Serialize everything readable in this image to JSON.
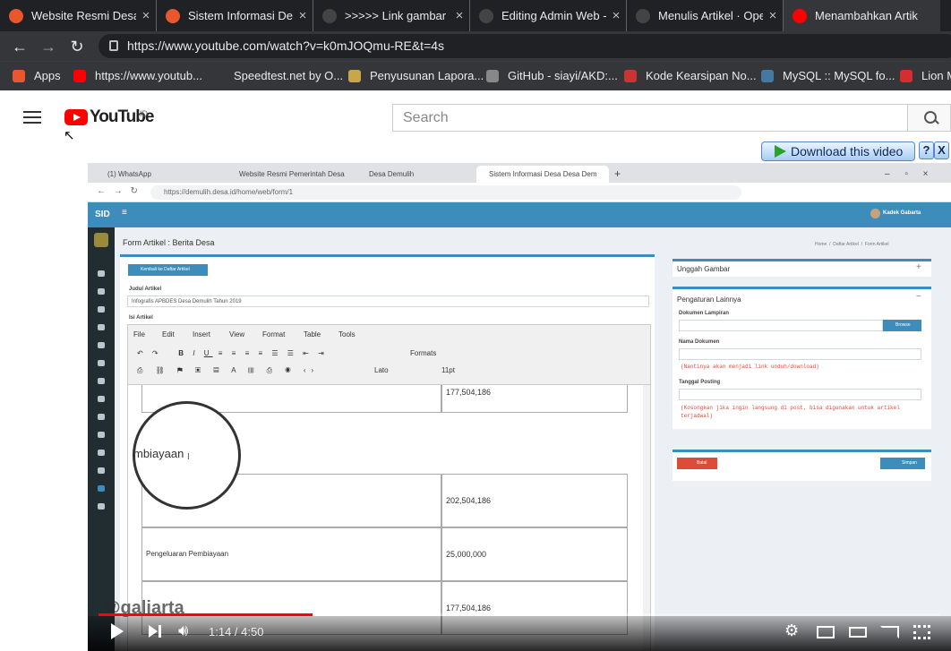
{
  "browser": {
    "tabs": [
      {
        "label": "Website Resmi Desa",
        "fav_color": "#e8572d"
      },
      {
        "label": "Sistem Informasi Des",
        "fav_color": "#e8572d"
      },
      {
        "label": ">>>>> Link gambar",
        "fav_color": "#444444"
      },
      {
        "label": "Editing Admin Web -",
        "fav_color": "#444444"
      },
      {
        "label": "Menulis Artikel · Ope",
        "fav_color": "#444444"
      },
      {
        "label": "Menambahkan Artik",
        "fav_color": "#ff0000"
      }
    ],
    "close_glyph": "×",
    "url": "https://www.youtube.com/watch?v=k0mJOQmu-RE&t=4s",
    "bookmarks": [
      {
        "label": "Apps",
        "color": "#e8572d"
      },
      {
        "label": "https://www.youtub...",
        "color": "#ff0000"
      },
      {
        "label": "Speedtest.net by O...",
        "color": "#35363a"
      },
      {
        "label": "Penyusunan Lapora...",
        "color": "#caa64a"
      },
      {
        "label": "GitHub - siayi/AKD:...",
        "color": "#888888"
      },
      {
        "label": "Kode Kearsipan No...",
        "color": "#cc3333"
      },
      {
        "label": "MySQL :: MySQL fo...",
        "color": "#4479a1"
      },
      {
        "label": "Lion M",
        "color": "#d62e2e"
      }
    ]
  },
  "youtube": {
    "logo_text": "YouTube",
    "region": "ID",
    "search_placeholder": "Search",
    "download_label": "Download this video",
    "help_label": "?",
    "close_label": "X"
  },
  "video": {
    "inner_tabs": [
      "(1) WhatsApp",
      "Website Resmi Pemerintah Desa",
      "Desa Demulih",
      "Sistem Informasi Desa Desa Dem"
    ],
    "inner_url": "https://demulih.desa.id/home/web/form/1",
    "sid_brand": "SID",
    "user_name": "Kadek Gabarta",
    "page_title": "Form Artikel : Berita Desa",
    "breadcrumb": "Home  /  Daftar Artikel  /  Form Artikel",
    "back_button": "Kembali ke Daftar Artikel",
    "judul_label": "Judul Artikel",
    "judul_value": "Infografis APBDES Desa Demulih Tahun 2019",
    "isi_label": "Isi Artikel",
    "editor_menu": [
      "File",
      "Edit",
      "Insert",
      "View",
      "Format",
      "Table",
      "Tools"
    ],
    "editor_formats": "Formats",
    "editor_font": "Lato",
    "editor_size": "11pt",
    "table_rows": [
      {
        "label": "",
        "value": "177,504,186"
      },
      {
        "label": "",
        "value": "202,504,186"
      },
      {
        "label": "Pengeluaran Pembiayaan",
        "value": "25,000,000"
      },
      {
        "label": "",
        "value": "177,504,186"
      }
    ],
    "magnified_text": "mbiayaan",
    "unggah_gambar": "Unggah Gambar",
    "pengaturan": "Pengaturan Lainnya",
    "lampiran_label": "Dokumen Lampiran",
    "browse_button": "Browse",
    "nama_dokumen_label": "Nama Dokumen",
    "nama_dokumen_hint": "(Nantinya akan menjadi link unduh/download)",
    "tanggal_label": "Tanggal Posting",
    "tanggal_hint": "(Kosongkan jika ingin langsung di post, bisa digunakan untuk artikel terjadwal)",
    "batal_button": "Batal",
    "simpan_button": "Simpan",
    "watermark": "@galiarta"
  },
  "player": {
    "time": "1:14 / 4:50",
    "progress_fraction": 0.254
  }
}
